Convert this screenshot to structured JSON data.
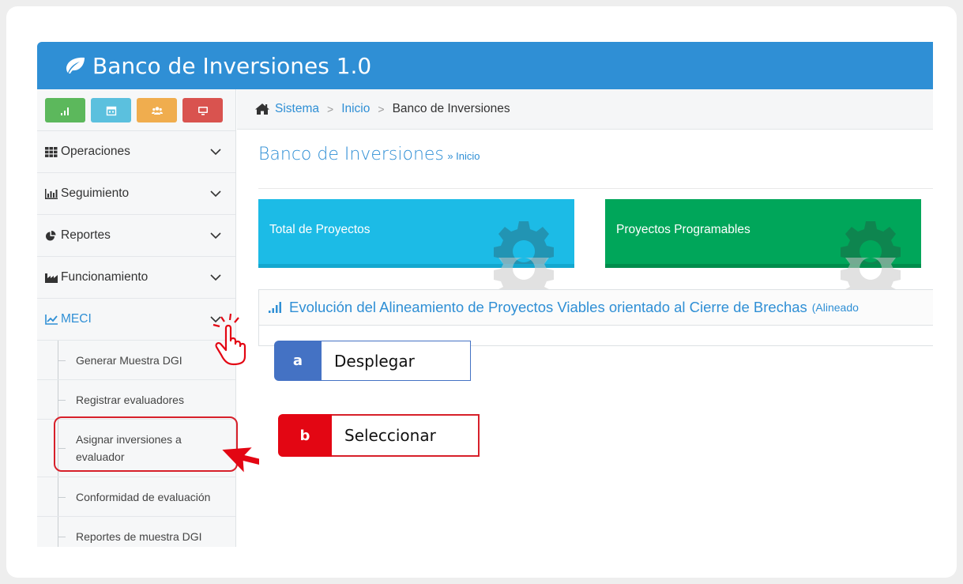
{
  "app": {
    "title": "Banco de Inversiones 1.0"
  },
  "quick_buttons": [
    {
      "icon": "bar-chart-icon",
      "color": "#5cb85c"
    },
    {
      "icon": "calendar-icon",
      "color": "#5bc0de"
    },
    {
      "icon": "users-icon",
      "color": "#f0ad4e"
    },
    {
      "icon": "monitor-icon",
      "color": "#d9534f"
    }
  ],
  "sidebar": {
    "items": [
      {
        "label": "Operaciones",
        "icon": "grid-icon"
      },
      {
        "label": "Seguimiento",
        "icon": "bar-chart-icon"
      },
      {
        "label": "Reportes",
        "icon": "pie-chart-icon"
      },
      {
        "label": "Funcionamiento",
        "icon": "industry-icon"
      },
      {
        "label": "MECI",
        "icon": "line-chart-icon"
      }
    ],
    "submenu": [
      "Generar Muestra DGI",
      "Registrar evaluadores",
      "Asignar inversiones a evaluador",
      "Conformidad de evaluación",
      "Reportes de muestra DGI"
    ]
  },
  "breadcrumb": {
    "items": [
      "Sistema",
      "Inicio",
      "Banco de Inversiones"
    ]
  },
  "page": {
    "title": "Banco de Inversiones",
    "subtitle": "» Inicio"
  },
  "tiles": [
    {
      "label": "Total de Proyectos",
      "color": "#1cbbe6"
    },
    {
      "label": "Proyectos Programables",
      "color": "#00a65a"
    }
  ],
  "panel": {
    "title": "Evolución del Alineamiento de Proyectos Viables orientado al Cierre de Brechas",
    "suffix": "(Alineado"
  },
  "callouts": {
    "a": {
      "letter": "a",
      "text": "Desplegar",
      "color": "#4472c4"
    },
    "b": {
      "letter": "b",
      "text": "Seleccionar",
      "color": "#e30613"
    }
  }
}
